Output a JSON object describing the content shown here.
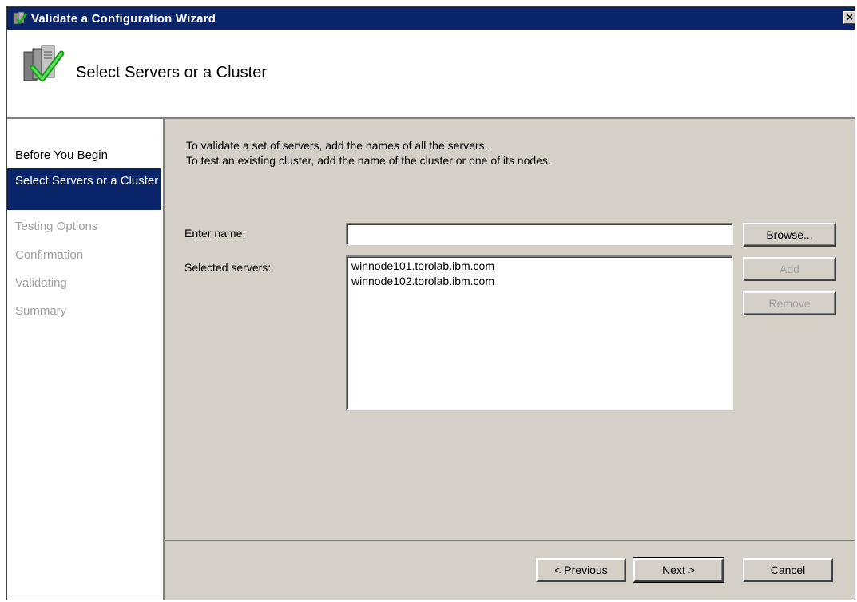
{
  "window": {
    "title": "Validate a Configuration Wizard",
    "close_glyph": "×"
  },
  "header": {
    "title": "Select Servers or a Cluster",
    "icon": "server-validate-icon"
  },
  "nav": {
    "items": [
      {
        "label": "Before You Begin",
        "state": "normal"
      },
      {
        "label": "Select Servers or a Cluster",
        "state": "active"
      },
      {
        "label": "Testing Options",
        "state": "disabled"
      },
      {
        "label": "Confirmation",
        "state": "disabled"
      },
      {
        "label": "Validating",
        "state": "disabled"
      },
      {
        "label": "Summary",
        "state": "disabled"
      }
    ]
  },
  "main": {
    "intro_line1": "To validate a set of servers, add the names of all the servers.",
    "intro_line2": "To test an existing cluster, add the name of the cluster or one of its nodes.",
    "enter_name_label": "Enter name:",
    "enter_name_value": "",
    "selected_servers_label": "Selected servers:",
    "selected_servers": [
      "winnode101.torolab.ibm.com",
      "winnode102.torolab.ibm.com"
    ]
  },
  "buttons": {
    "browse": "Browse...",
    "add": "Add",
    "remove": "Remove",
    "previous": "< Previous",
    "next": "Next >",
    "cancel": "Cancel"
  },
  "colors": {
    "title_bar": "#0a246a",
    "dialog_face": "#d4d0c8",
    "disabled_text": "#a0a0a0"
  }
}
